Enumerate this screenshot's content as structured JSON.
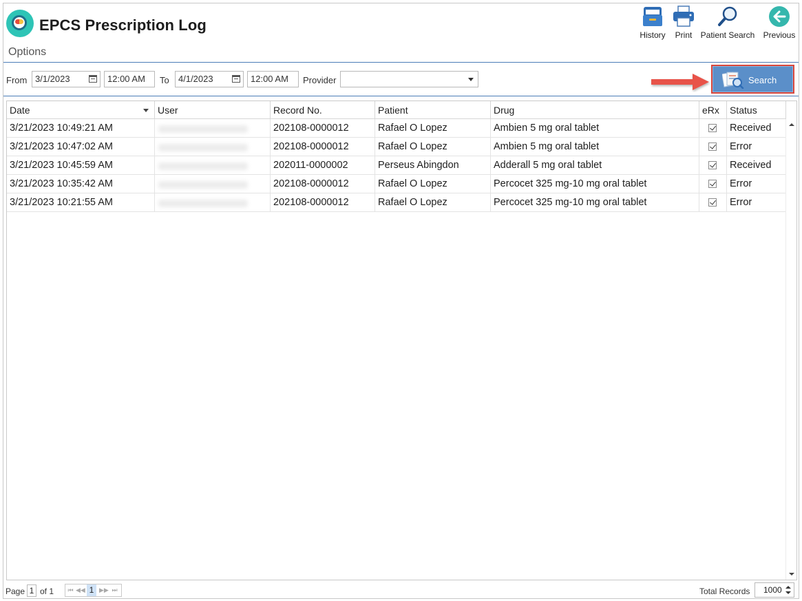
{
  "header": {
    "title": "EPCS Prescription Log",
    "options_label": "Options"
  },
  "toolbar": {
    "history": "History",
    "print": "Print",
    "patient_search": "Patient Search",
    "previous": "Previous"
  },
  "filters": {
    "from_label": "From",
    "from_date": "3/1/2023",
    "from_time": "12:00 AM",
    "to_label": "To",
    "to_date": "4/1/2023",
    "to_time": "12:00 AM",
    "provider_label": "Provider",
    "provider_value": "",
    "search_label": "Search"
  },
  "grid": {
    "columns": [
      "Date",
      "User",
      "Record No.",
      "Patient",
      "Drug",
      "eRx",
      "Status"
    ],
    "rows": [
      {
        "date": "3/21/2023 10:49:21 AM",
        "record": "202108-0000012",
        "patient": "Rafael O Lopez",
        "drug": "Ambien 5 mg oral tablet",
        "erx": true,
        "status": "Received"
      },
      {
        "date": "3/21/2023 10:47:02 AM",
        "record": "202108-0000012",
        "patient": "Rafael O Lopez",
        "drug": "Ambien 5 mg oral tablet",
        "erx": true,
        "status": "Error"
      },
      {
        "date": "3/21/2023 10:45:59 AM",
        "record": "202011-0000002",
        "patient": "Perseus Abingdon",
        "drug": "Adderall 5 mg oral tablet",
        "erx": true,
        "status": "Received"
      },
      {
        "date": "3/21/2023 10:35:42 AM",
        "record": "202108-0000012",
        "patient": "Rafael O Lopez",
        "drug": "Percocet 325 mg-10 mg oral tablet",
        "erx": true,
        "status": "Error"
      },
      {
        "date": "3/21/2023 10:21:55 AM",
        "record": "202108-0000012",
        "patient": "Rafael O Lopez",
        "drug": "Percocet 325 mg-10 mg oral tablet",
        "erx": true,
        "status": "Error"
      }
    ]
  },
  "footer": {
    "page_label": "Page",
    "page_value": "1",
    "of_label": "of 1",
    "pager_current": "1",
    "total_records_label": "Total Records",
    "total_records_value": "1000"
  },
  "colors": {
    "accent_rule": "#4a7cb7",
    "search_button": "#5b8fc9",
    "annotation": "#e8534a"
  }
}
